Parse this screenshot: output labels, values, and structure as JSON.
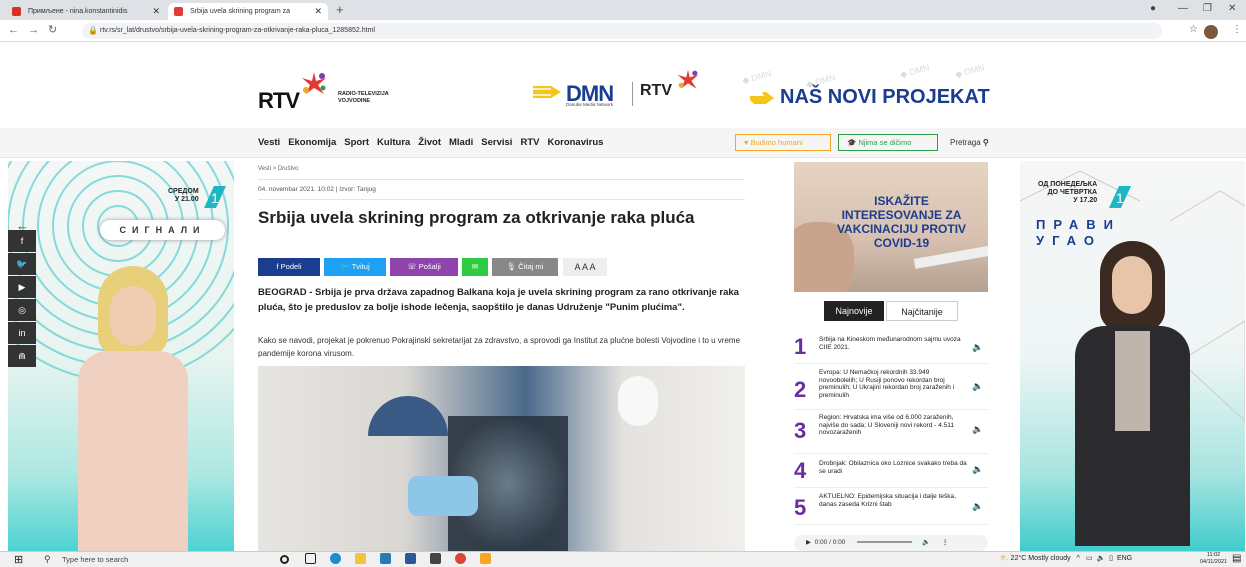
{
  "browser": {
    "tabs": [
      {
        "label": "Примљене - nina.konstantinidis"
      },
      {
        "label": "Srbija uvela skrining program za"
      }
    ],
    "url": "rtv.rs/sr_lat/drustvo/srbija-uvela-skrining-program-za-otkrivanje-raka-pluca_1285852.html"
  },
  "header": {
    "rtv_logo": "RTV",
    "rtv_sub1": "RADIO-TELEVIZIJA",
    "rtv_sub2": "VOJVODINE",
    "dmn": "DMN",
    "dmn_sub": "Danube Media Network",
    "rtv_small": "RTV",
    "project": "NAŠ NOVI PROJEKAT"
  },
  "nav": {
    "items": [
      "Vesti",
      "Ekonomija",
      "Sport",
      "Kultura",
      "Život",
      "Mladi",
      "Servisi",
      "RTV",
      "Koronavirus"
    ],
    "btn1": "Budimo humani",
    "btn2": "Njima se dičimo",
    "search": "Pretraga"
  },
  "article": {
    "breadcrumb": "Vesti > Društvo",
    "meta": "04. novembar 2021. 10:02 | Izvor: Tanjug",
    "title": "Srbija uvela skrining program za otkrivanje raka pluća",
    "share": [
      "Podeli",
      "Tvituj",
      "Pošalji",
      "",
      "Čitaj mi"
    ],
    "fontsize": "A A A",
    "lead": "BEOGRAD - Srbija je prva država zapadnog Balkana koja je uvela skrining program za rano otkrivanje raka pluća, što je preduslov za bolje ishode lečenja, saopštilo je danas Udruženje \"Punim plućima\".",
    "body": "Kako se navodi, projekat je pokrenuo Pokrajinski sekretarijat za zdravstvo, a sprovodi ga Institut za plućne bolesti Vojvodine i to u vreme pandemije korona virusom."
  },
  "ads": {
    "left_top": "СРЕДОМ",
    "left_time": "У 21.00",
    "left_show": "СИГНАЛИ",
    "right_top": "ОД ПОНЕДЕЉКА",
    "right_mid": "ДО ЧЕТВРТКА",
    "right_time": "У 17.20",
    "right_show1": "ПРАВИ",
    "right_show2": "УГАО",
    "covid": "ISKAŽITE INTERESOVANJE ZA VAKCINACIJU PROTIV COVID-19"
  },
  "sidebar": {
    "tab1": "Najnovije",
    "tab2": "Najčitanije",
    "items": [
      {
        "num": "1",
        "text": "Srbija na Kineskom međunarodnom sajmu uvoza CIIE 2021."
      },
      {
        "num": "2",
        "text": "Evropa: U Nemačkoj rekordnih 33.949 novoobolelih; U Rusiji ponovo rekordan broj preminulih; U Ukrajini rekordan broj zaraženih i preminulih"
      },
      {
        "num": "3",
        "text": "Region: Hrvatska ima više od 6.000 zaraženih, najviše do sada; U Sloveniji novi rekord - 4.511 novozaraženih"
      },
      {
        "num": "4",
        "text": "Drobnjak: Obilaznica oko Loznice svakako treba da se uradi"
      },
      {
        "num": "5",
        "text": "AKTUELNO: Epidemijska situacija i dalje teška, danas zaseda Krizni štab"
      }
    ],
    "audio": "0:00 / 0:00"
  },
  "taskbar": {
    "search": "Type here to search",
    "weather": "22°C Mostly cloudy",
    "lang": "ENG",
    "time": "11:02",
    "date": "04/11/2021"
  }
}
